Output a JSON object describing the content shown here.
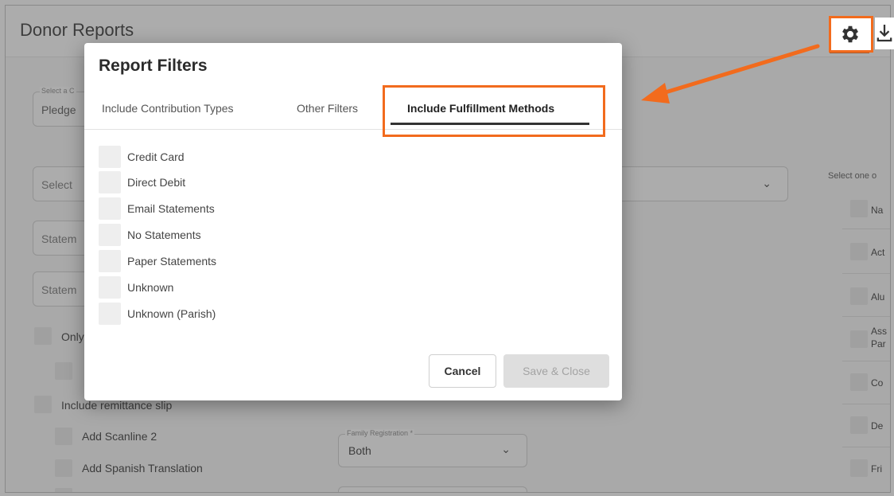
{
  "header": {
    "title": "Donor Reports"
  },
  "icons": {
    "settings": "gear-icon",
    "download": "download-icon"
  },
  "background": {
    "select_campaign_label": "Select a C",
    "select_campaign_value": "Pledge",
    "select_input_placeholder": "Select",
    "statement_field_1": "Statem",
    "statement_field_2": "Statem",
    "only_label": "Only",
    "include_remittance_label": "Include remittance slip",
    "add_scanline_label": "Add Scanline 2",
    "add_spanish_label": "Add Spanish Translation",
    "family_registration_label": "Family Registration *",
    "family_registration_value": "Both",
    "right_col_heading": "Select one o",
    "right_col_items": [
      "Na",
      "Act",
      "Alu",
      "Ass",
      "Par",
      "Co",
      "De",
      "Fri"
    ]
  },
  "modal": {
    "title": "Report Filters",
    "tabs": [
      {
        "label": "Include Contribution Types"
      },
      {
        "label": "Other Filters"
      },
      {
        "label": "Include Fulfillment Methods"
      }
    ],
    "active_tab": "Include Fulfillment Methods",
    "options": [
      {
        "label": "Credit Card",
        "checked": false
      },
      {
        "label": "Direct Debit",
        "checked": false
      },
      {
        "label": "Email Statements",
        "checked": false
      },
      {
        "label": "No Statements",
        "checked": false
      },
      {
        "label": "Paper Statements",
        "checked": false
      },
      {
        "label": "Unknown",
        "checked": false
      },
      {
        "label": "Unknown (Parish)",
        "checked": false
      }
    ],
    "cancel_label": "Cancel",
    "save_label": "Save & Close"
  },
  "colors": {
    "highlight": "#f26b1d",
    "disabled_button": "#dedede"
  }
}
